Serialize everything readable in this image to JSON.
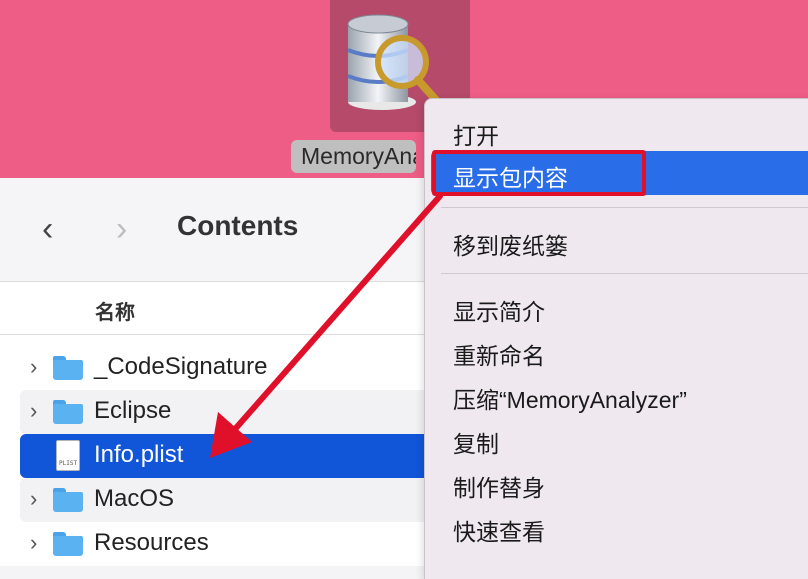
{
  "desktop": {
    "app_label": "MemoryAnalyzer",
    "background": "#ee5d86"
  },
  "finder": {
    "title": "Contents",
    "column_name": "名称",
    "back_glyph": "‹",
    "forward_glyph": "›",
    "items": [
      {
        "name": "_CodeSignature",
        "kind": "folder",
        "expandable": true
      },
      {
        "name": "Eclipse",
        "kind": "folder",
        "expandable": true
      },
      {
        "name": "Info.plist",
        "kind": "file",
        "expandable": false,
        "selected": true,
        "badge": "PLIST"
      },
      {
        "name": "MacOS",
        "kind": "folder",
        "expandable": true
      },
      {
        "name": "Resources",
        "kind": "folder",
        "expandable": true
      }
    ]
  },
  "context_menu": {
    "open": "打开",
    "show_package_contents": "显示包内容",
    "move_to_trash": "移到废纸篓",
    "get_info": "显示简介",
    "rename": "重新命名",
    "compress": "压缩“MemoryAnalyzer”",
    "duplicate": "复制",
    "make_alias": "制作替身",
    "quick_look": "快速查看"
  },
  "colors": {
    "selection": "#1155d8",
    "menu_highlight": "#2a6de9",
    "annotation": "#e0102a"
  }
}
